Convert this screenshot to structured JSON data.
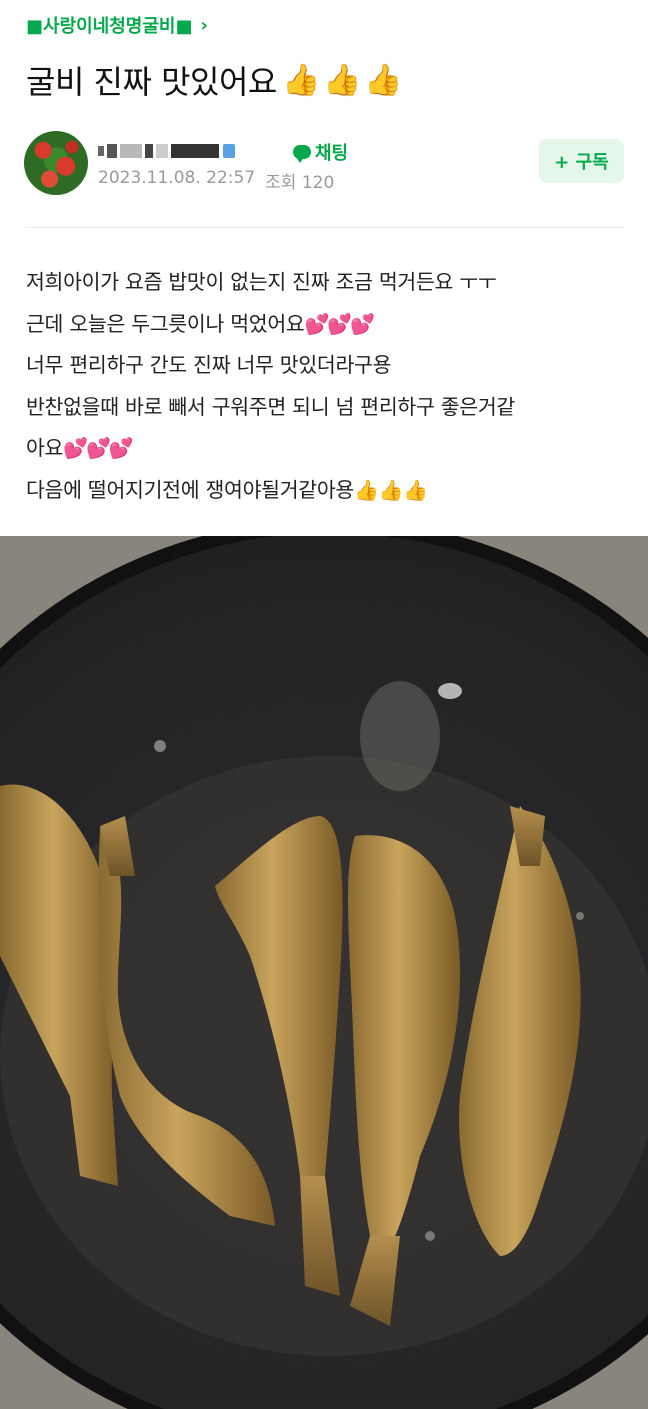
{
  "board": {
    "name": "■사랑이네청명굴비■",
    "chevron": "›"
  },
  "post": {
    "title": "굴비 진짜 맛있어요",
    "title_emoji": [
      "👍",
      "👍",
      "👍"
    ]
  },
  "author": {
    "chat_label": "채팅",
    "date": "2023.11.08. 22:57",
    "views": "조회 120",
    "subscribe_label": "+ 구독"
  },
  "body": {
    "lines": [
      {
        "text": "저희아이가 요즘 밥맛이 없는지 진짜 조금 먹거든요 ㅜㅜ",
        "emoji": ""
      },
      {
        "text": "근데 오늘은 두그릇이나 먹었어요",
        "emoji": "💕💕💕"
      },
      {
        "text": "너무 편리하구 간도 진짜 너무 맛있더라구용",
        "emoji": ""
      },
      {
        "text": "반찬없을때 바로 빼서 구워주면 되니 넘 편리하구 좋은거같",
        "emoji": ""
      },
      {
        "text": "아요",
        "emoji": "💕💕💕"
      },
      {
        "text": "다음에 떨어지기전에 쟁여야될거같아용",
        "emoji": "👍👍👍"
      }
    ]
  },
  "colors": {
    "accent_green": "#03a94a",
    "subscribe_bg": "#e5f6ea",
    "meta_gray": "#9a9a9a"
  },
  "icons": {
    "chat": "speech-bubble-icon",
    "chevron": "chevron-right-icon"
  }
}
